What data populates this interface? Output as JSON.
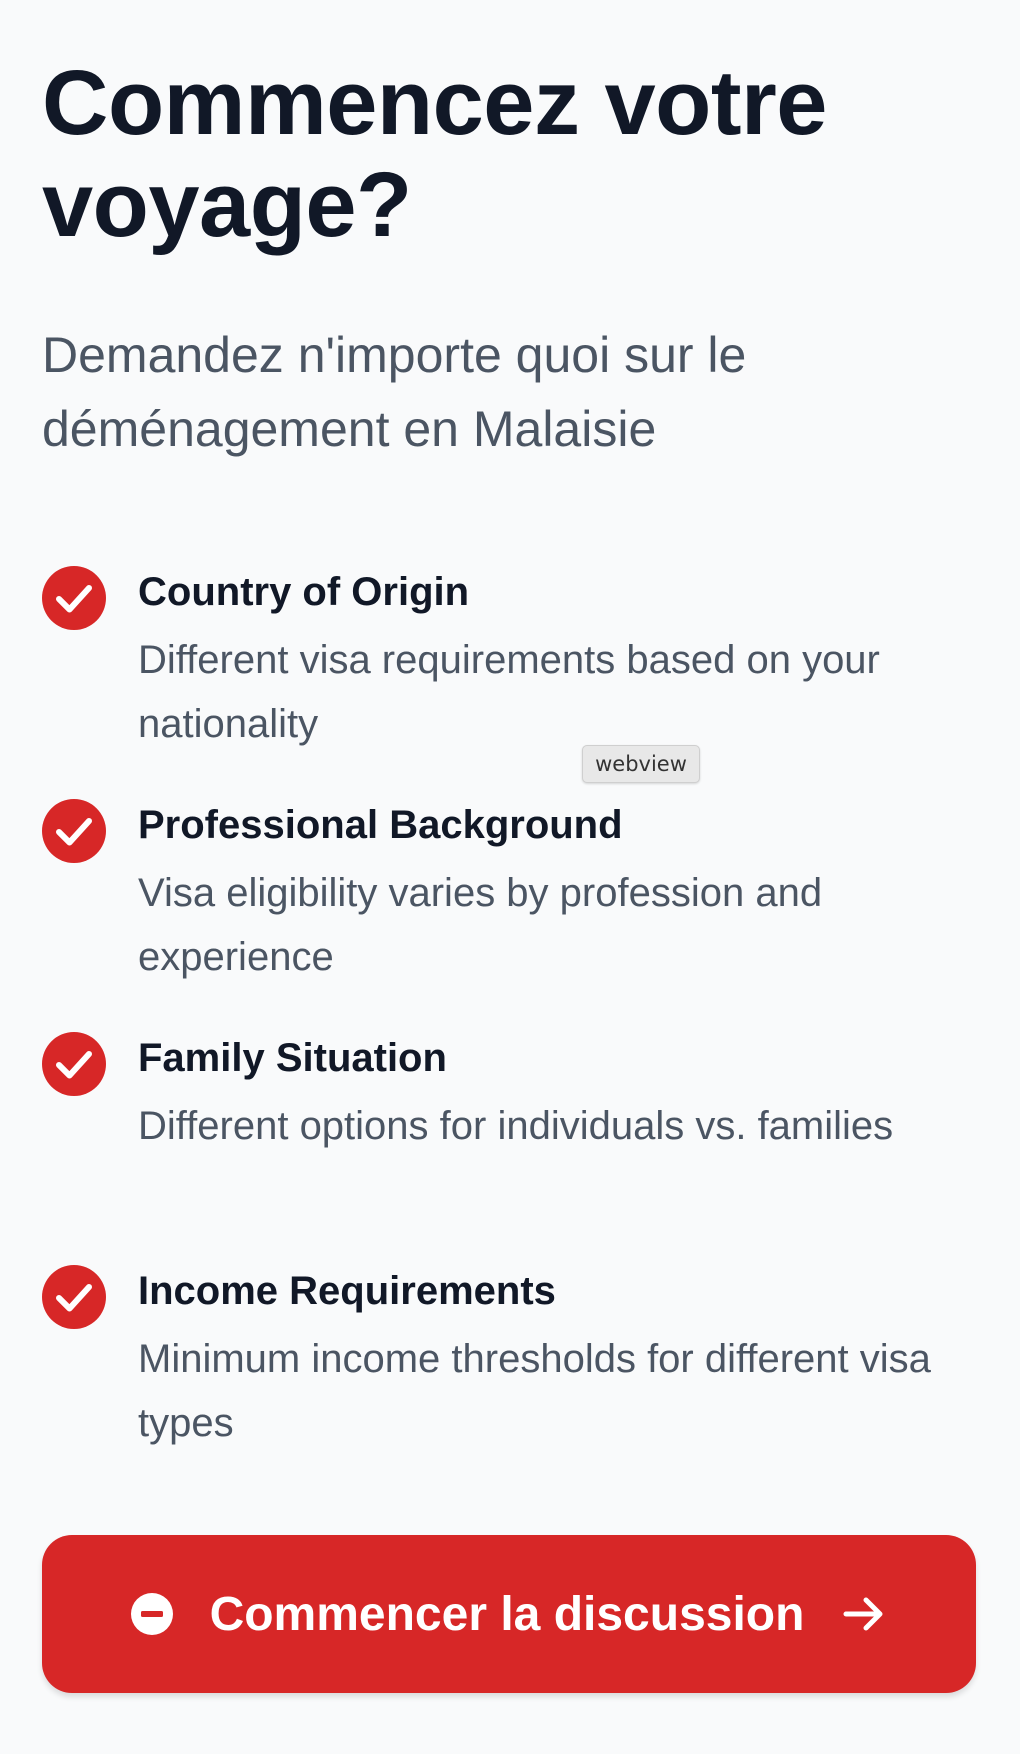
{
  "hero": {
    "title": "Commencez votre voyage?",
    "subtitle": "Demandez n'importe quoi sur le déménagement en Malaisie"
  },
  "features": [
    {
      "icon": "check-circle-icon",
      "title": "Country of Origin",
      "description": "Different visa requirements based on your nationality"
    },
    {
      "icon": "check-circle-icon",
      "title": "Professional Background",
      "description": "Visa eligibility varies by profession and experience"
    },
    {
      "icon": "check-circle-icon",
      "title": "Family Situation",
      "description": "Different options for individuals vs. families"
    },
    {
      "icon": "check-circle-icon",
      "title": "Income Requirements",
      "description": "Minimum income thresholds for different visa types"
    }
  ],
  "tooltip": {
    "label": "webview"
  },
  "cta": {
    "label": "Commencer la discussion",
    "left_icon": "chat-bubble-icon",
    "right_icon": "arrow-right-icon"
  },
  "colors": {
    "accent": "#d72727",
    "heading": "#111827",
    "body_text": "#4b5563",
    "background": "#f9fafb"
  }
}
